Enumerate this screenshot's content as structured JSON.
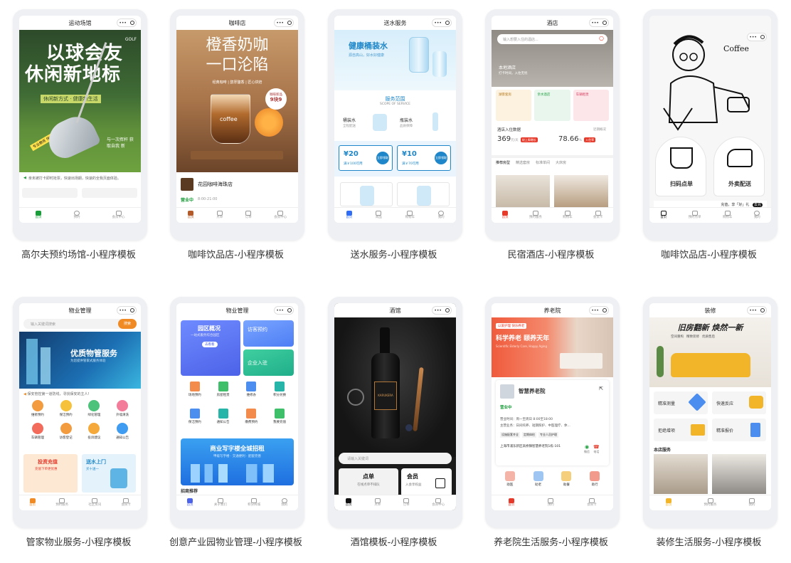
{
  "templates": [
    {
      "caption": "高尔夫预约场馆-小程序模板",
      "nav_title": "运动场馆",
      "hero_title_1": "以球会友",
      "hero_title_2": "休闲新地标",
      "hero_slogan": "休闲新方式 · 健康新生活",
      "hero_tag": "GOLF",
      "hero_badge": "专业教练 快速入门",
      "hero_side": "与一次挥杆 获取自我 新",
      "notice": "亲未被打卡即时抢票，快速出场期，快速的全我页面体验。",
      "tabs": [
        "首页",
        "预约",
        "会员中心"
      ]
    },
    {
      "caption": "咖啡饮品店-小程序模板",
      "nav_title": "咖啡店",
      "hero_title_1": "橙香奶咖",
      "hero_title_2": "一口沦陷",
      "hero_sub": "经典咖啡 | 醇厚馥香 | 匠心烘焙",
      "price_tag_1": "咖啡新品",
      "price_tag_2": "9块9",
      "cup_label": "coffee",
      "shop_name": "花园咖啡海珠店",
      "status": "营业中",
      "hours": "8:00-21:00",
      "tabs": [
        "首页",
        "点单",
        "订单",
        "会员中心"
      ]
    },
    {
      "caption": "送水服务-小程序模板",
      "nav_title": "送水服务",
      "hero_title": "健康桶装水",
      "hero_sub": "源自高山，好水好健康",
      "service_title": "服务范围",
      "service_sub": "SCOPE OF SERVICE",
      "service_1": "桶装水",
      "service_1_sub": "全程配送",
      "service_2": "瓶装水",
      "service_2_sub": "品质保障",
      "coupon_1_value": "¥20",
      "coupon_1_cond": "满￥100可用",
      "coupon_2_value": "¥10",
      "coupon_2_cond": "满￥70可用",
      "coupon_btn": "立即领取",
      "tabs": [
        "首页",
        "商品",
        "购物车",
        "我的"
      ]
    },
    {
      "caption": "民宿酒店-小程序模板",
      "nav_title": "酒店",
      "search_placeholder": "输入想要入住的酒店...",
      "hero_text": "本地酒店",
      "hero_sub": "打卡时间，入住无忧",
      "cat_1": "湖景套房",
      "cat_2": "亲水酒店",
      "cat_3": "车辆租赁",
      "stat_title": "酒店入住数据",
      "stat_link": "近期概况",
      "stat_1": "369",
      "stat_1_unit": "元/天",
      "stat_1_tag": "较上周增长",
      "stat_2": "78.66",
      "stat_2_unit": "%",
      "stat_2_tag": "入住率",
      "room_tabs": [
        "推荐房型",
        "精选套房",
        "标准单间",
        "大床房"
      ],
      "tabs": [
        "首页",
        "预约服务",
        "购物车",
        "会员卡"
      ]
    },
    {
      "caption": "咖啡饮品店-小程序模板",
      "hero_word": "Coffee",
      "action_1": "扫码点单",
      "action_2": "外卖配送",
      "banner_text": "充值，享「好」礼",
      "banner_btn": "去充",
      "tabs": [
        "首页",
        "预约点单",
        "购物车",
        "我的"
      ]
    },
    {
      "caption": "管家物业服务-小程序模板",
      "nav_title": "物业管理",
      "search_placeholder": "输入关键词搜索",
      "search_btn": "搜索",
      "hero_title": "优质物管服务",
      "hero_sub": "为您提供管家式服务体验",
      "notice": "保安管控第一道防线，寻找保安的主人!",
      "icons": [
        "维修预约",
        "保洁预约",
        "绿化管理",
        "外墙清洗",
        "车辆管理",
        "访客登记",
        "投诉建议",
        "通知公告"
      ],
      "promo_1": "投资充值",
      "promo_1_sub": "充值下单更优惠",
      "promo_2": "送水上门",
      "promo_2_sub": "买十送一",
      "tabs": [
        "首页",
        "预约服务",
        "社区资讯",
        "会员卡"
      ]
    },
    {
      "caption": "创意产业园物业管理-小程序模板",
      "nav_title": "物业管理",
      "card_1": "园区概况",
      "card_1_sub": "一站式服务综合园区",
      "card_1_btn": "去看看",
      "card_2": "访客预约",
      "card_3": "企业入驻",
      "icons": [
        "场地预约",
        "房屋租赁",
        "维修办",
        "积分兑换",
        "保洁预约",
        "通知公告",
        "缴费预约",
        "我要充值"
      ],
      "banner_title": "商业写字楼全城招租",
      "banner_sub": "甲级写字楼 · 交通便利 · 配套完善",
      "section": "招商推荐",
      "tabs": [
        "首页",
        "关于我们",
        "积分商城",
        "我的"
      ]
    },
    {
      "caption": "酒馆模板-小程序模板",
      "nav_title": "酒馆",
      "bottle_label": "KARUKERA",
      "search_placeholder": "请输入关键词",
      "card_1": "点单",
      "card_1_sub": "在线点单不排队",
      "card_2": "会员",
      "card_2_sub": "入会享权益",
      "tabs": [
        "首页",
        "点单",
        "订单",
        "会员中心"
      ]
    },
    {
      "caption": "养老院生活服务-小程序模板",
      "nav_title": "养老院",
      "hero_badge": "以爱护理 快乐养老",
      "hero_title": "科学养老 颐养天年",
      "hero_sub": "Scientific Elderly Care, Happy Aging",
      "shop_name": "智慧养老院",
      "status": "营业中",
      "info_1": "营业时间：周一至周日 8:00至18:00",
      "info_2": "主营业务：日间托养、短期照护、中医理疗、休...",
      "info_tags": [
        "设施配套齐全",
        "定期体检",
        "专业人员护理"
      ],
      "address": "上海市浦东新区高桥镇智慧养老院1栋-101",
      "addr_actions": [
        "微信",
        "电话"
      ],
      "icons": [
        "助医",
        "助老",
        "助餐",
        "助行"
      ],
      "tabs": [
        "首页",
        "预约",
        "会员卡"
      ]
    },
    {
      "caption": "装修生活服务-小程序模板",
      "nav_title": "装修",
      "hero_title": "旧房翻新 焕然一新",
      "hero_tags": [
        "空间重构",
        "精致装修",
        "优质售后"
      ],
      "service_1": "精准测量",
      "service_2": "快速反应",
      "service_3": "拒绝增项",
      "service_4": "精准报价",
      "section": "本店服务",
      "tabs": [
        "首页",
        "预约服务",
        "我的"
      ]
    }
  ],
  "colors": {
    "accent_red": "#e6392a",
    "orange": "#f08a24",
    "blue": "#2f6df6",
    "green": "#1a9c3a"
  }
}
